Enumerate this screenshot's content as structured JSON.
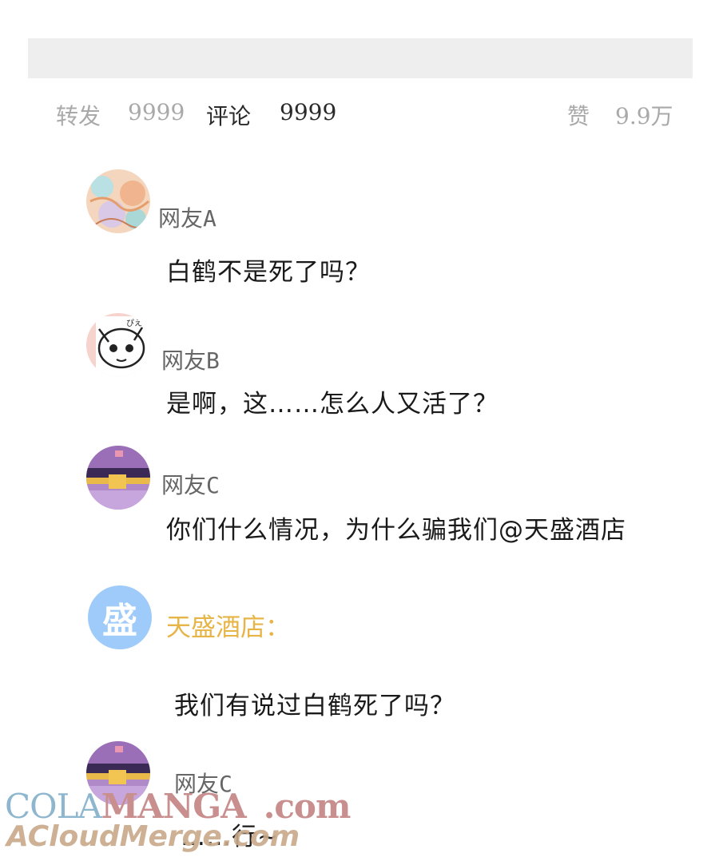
{
  "stats": {
    "repost_label": "转发",
    "repost_count": "9999",
    "comment_label": "评论",
    "comment_count": "9999",
    "like_label": "赞",
    "like_count": "9.9万"
  },
  "comments": [
    {
      "user": "网友A",
      "text": "白鹤不是死了吗？"
    },
    {
      "user": "网友B",
      "text": "是啊，这……怎么人又活了？"
    },
    {
      "user": "网友C",
      "text": "你们什么情况，为什么骗我们@天盛酒店"
    },
    {
      "user": "天盛酒店：",
      "avatar_char": "盛",
      "text": "我们有说过白鹤死了吗？"
    },
    {
      "user": "网友C",
      "text": "……行~"
    }
  ],
  "watermark": {
    "line1_a": "COLA",
    "line1_b": "MANGA",
    "line1_c": ".com",
    "line2": "ACloudMerge.com"
  },
  "colors": {
    "hotel_name": "#e7b447",
    "hotel_avatar": "#9fcbfa",
    "muted_text": "#a9a9a9"
  }
}
